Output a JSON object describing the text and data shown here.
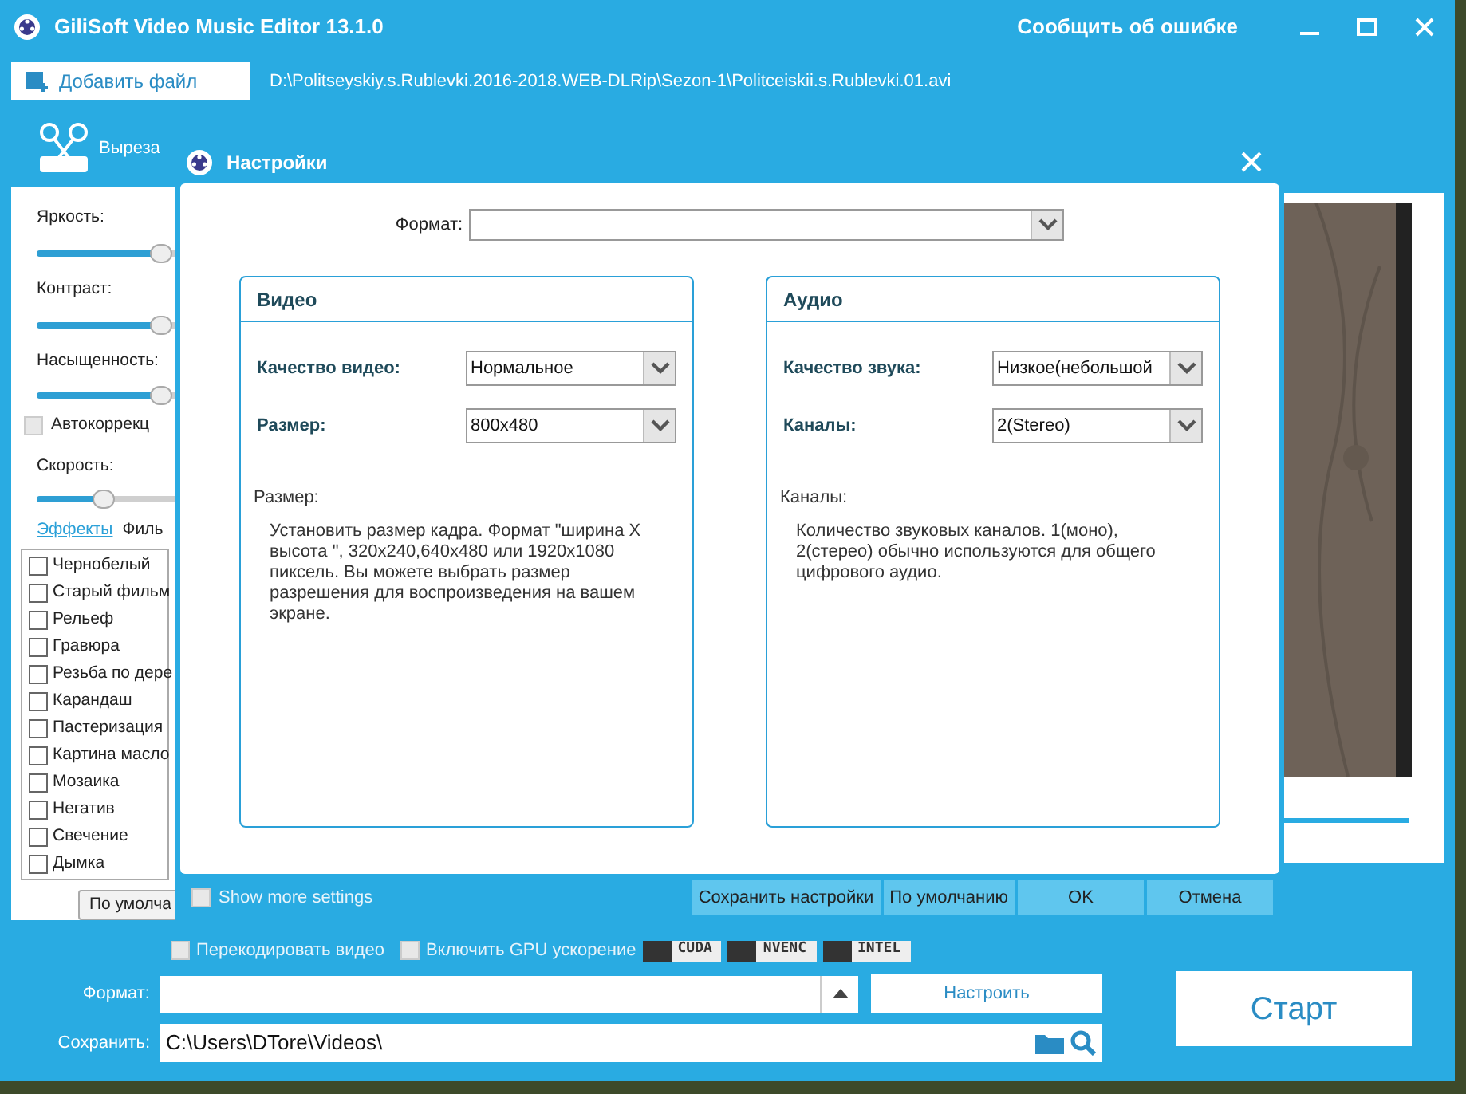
{
  "window": {
    "title": "GiliSoft Video Music Editor 13.1.0",
    "report_link": "Сообщить об ошибке"
  },
  "add_file_button": "Добавить файл",
  "file_path": "D:\\Politseyskiy.s.Rublevki.2016-2018.WEB-DLRip\\Sezon-1\\Politceiskii.s.Rublevki.01.avi",
  "toolbar": {
    "label": "Выреза"
  },
  "left_panel": {
    "sliders": [
      {
        "label": "Яркость:",
        "level": 0.56
      },
      {
        "label": "Контраст:",
        "level": 0.56
      },
      {
        "label": "Насыщенность:",
        "level": 0.56
      }
    ],
    "autocorrect": {
      "label": "Автокоррекц",
      "checked": false
    },
    "speed": {
      "label": "Скорость:",
      "level": 0.3
    },
    "tabs": [
      {
        "label": "Эффекты",
        "selected": true
      },
      {
        "label": "Филь",
        "selected": false
      }
    ],
    "effects": [
      {
        "label": "Чернобелый",
        "checked": false
      },
      {
        "label": "Старый фильм",
        "checked": false
      },
      {
        "label": "Рельеф",
        "checked": false
      },
      {
        "label": "Гравюра",
        "checked": false
      },
      {
        "label": "Резьба по дере",
        "checked": false
      },
      {
        "label": "Карандаш",
        "checked": false
      },
      {
        "label": "Пастеризация",
        "checked": false
      },
      {
        "label": "Картина масло",
        "checked": false
      },
      {
        "label": "Мозаика",
        "checked": false
      },
      {
        "label": "Негатив",
        "checked": false
      },
      {
        "label": "Свечение",
        "checked": false
      },
      {
        "label": "Дымка",
        "checked": false
      }
    ],
    "default_button": "По умолча"
  },
  "bottom": {
    "recode": {
      "label": "Перекодировать видео",
      "checked": false
    },
    "gpu": {
      "label": "Включить GPU ускорение",
      "checked": false
    },
    "gpu_badges": [
      "CUDA",
      "NVENC",
      "INTEL"
    ],
    "format_label": "Формат:",
    "configure_button": "Настроить",
    "save_label": "Сохранить:",
    "save_path": "C:\\Users\\DTore\\Videos\\",
    "start_button": "Старт"
  },
  "dialog": {
    "title": "Настройки",
    "format_label": "Формат:",
    "groups": [
      {
        "title": "Видео",
        "fields": [
          {
            "label": "Качество видео:",
            "value": "Нормальное"
          },
          {
            "label": "Размер:",
            "value": "800x480"
          }
        ],
        "help_title": "Размер:",
        "help_text": "Установить размер кадра. Формат \"ширина X высота \", 320x240,640x480 или 1920x1080 пиксель. Вы можете выбрать размер разрешения для воспроизведения на вашем экране."
      },
      {
        "title": "Аудио",
        "fields": [
          {
            "label": "Качество звука:",
            "value": "Низкое(небольшой"
          },
          {
            "label": "Каналы:",
            "value": "2(Stereo)"
          }
        ],
        "help_title": "Каналы:",
        "help_text": "Количество звуковых каналов. 1(моно), 2(стерео) обычно используются для общего цифрового аудио."
      }
    ],
    "show_more": {
      "label": "Show more settings",
      "checked": false
    },
    "buttons": [
      "Сохранить настройки",
      "По умолчанию",
      "OK",
      "Отмена"
    ]
  }
}
